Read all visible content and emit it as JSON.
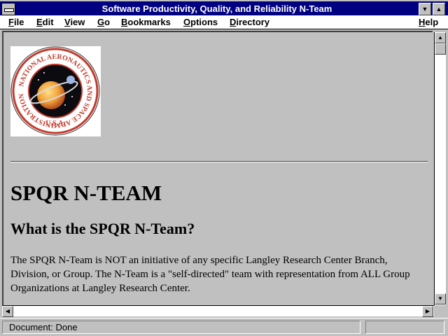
{
  "window": {
    "title": "Software Productivity, Quality, and Reliability N-Team"
  },
  "menubar": {
    "items": [
      "File",
      "Edit",
      "View",
      "Go",
      "Bookmarks",
      "Options",
      "Directory"
    ],
    "help": "Help"
  },
  "page": {
    "logo": {
      "icon": "nasa-seal",
      "text": "NATIONAL AERONAUTICS AND SPACE ADMINISTRATION",
      "country": "U.S.A."
    },
    "heading": "SPQR N-TEAM",
    "subheading": "What is the SPQR N-Team?",
    "paragraph": "The SPQR N-Team is NOT an initiative of any specific Langley Research Center Branch, Division, or Group. The N-Team is a \"self-directed\" team with representation from ALL Group Organizations at Langley Research Center."
  },
  "status": {
    "text": "Document: Done"
  },
  "colors": {
    "titlebar": "#000080",
    "chrome": "#c0c0c0",
    "text": "#000000"
  }
}
